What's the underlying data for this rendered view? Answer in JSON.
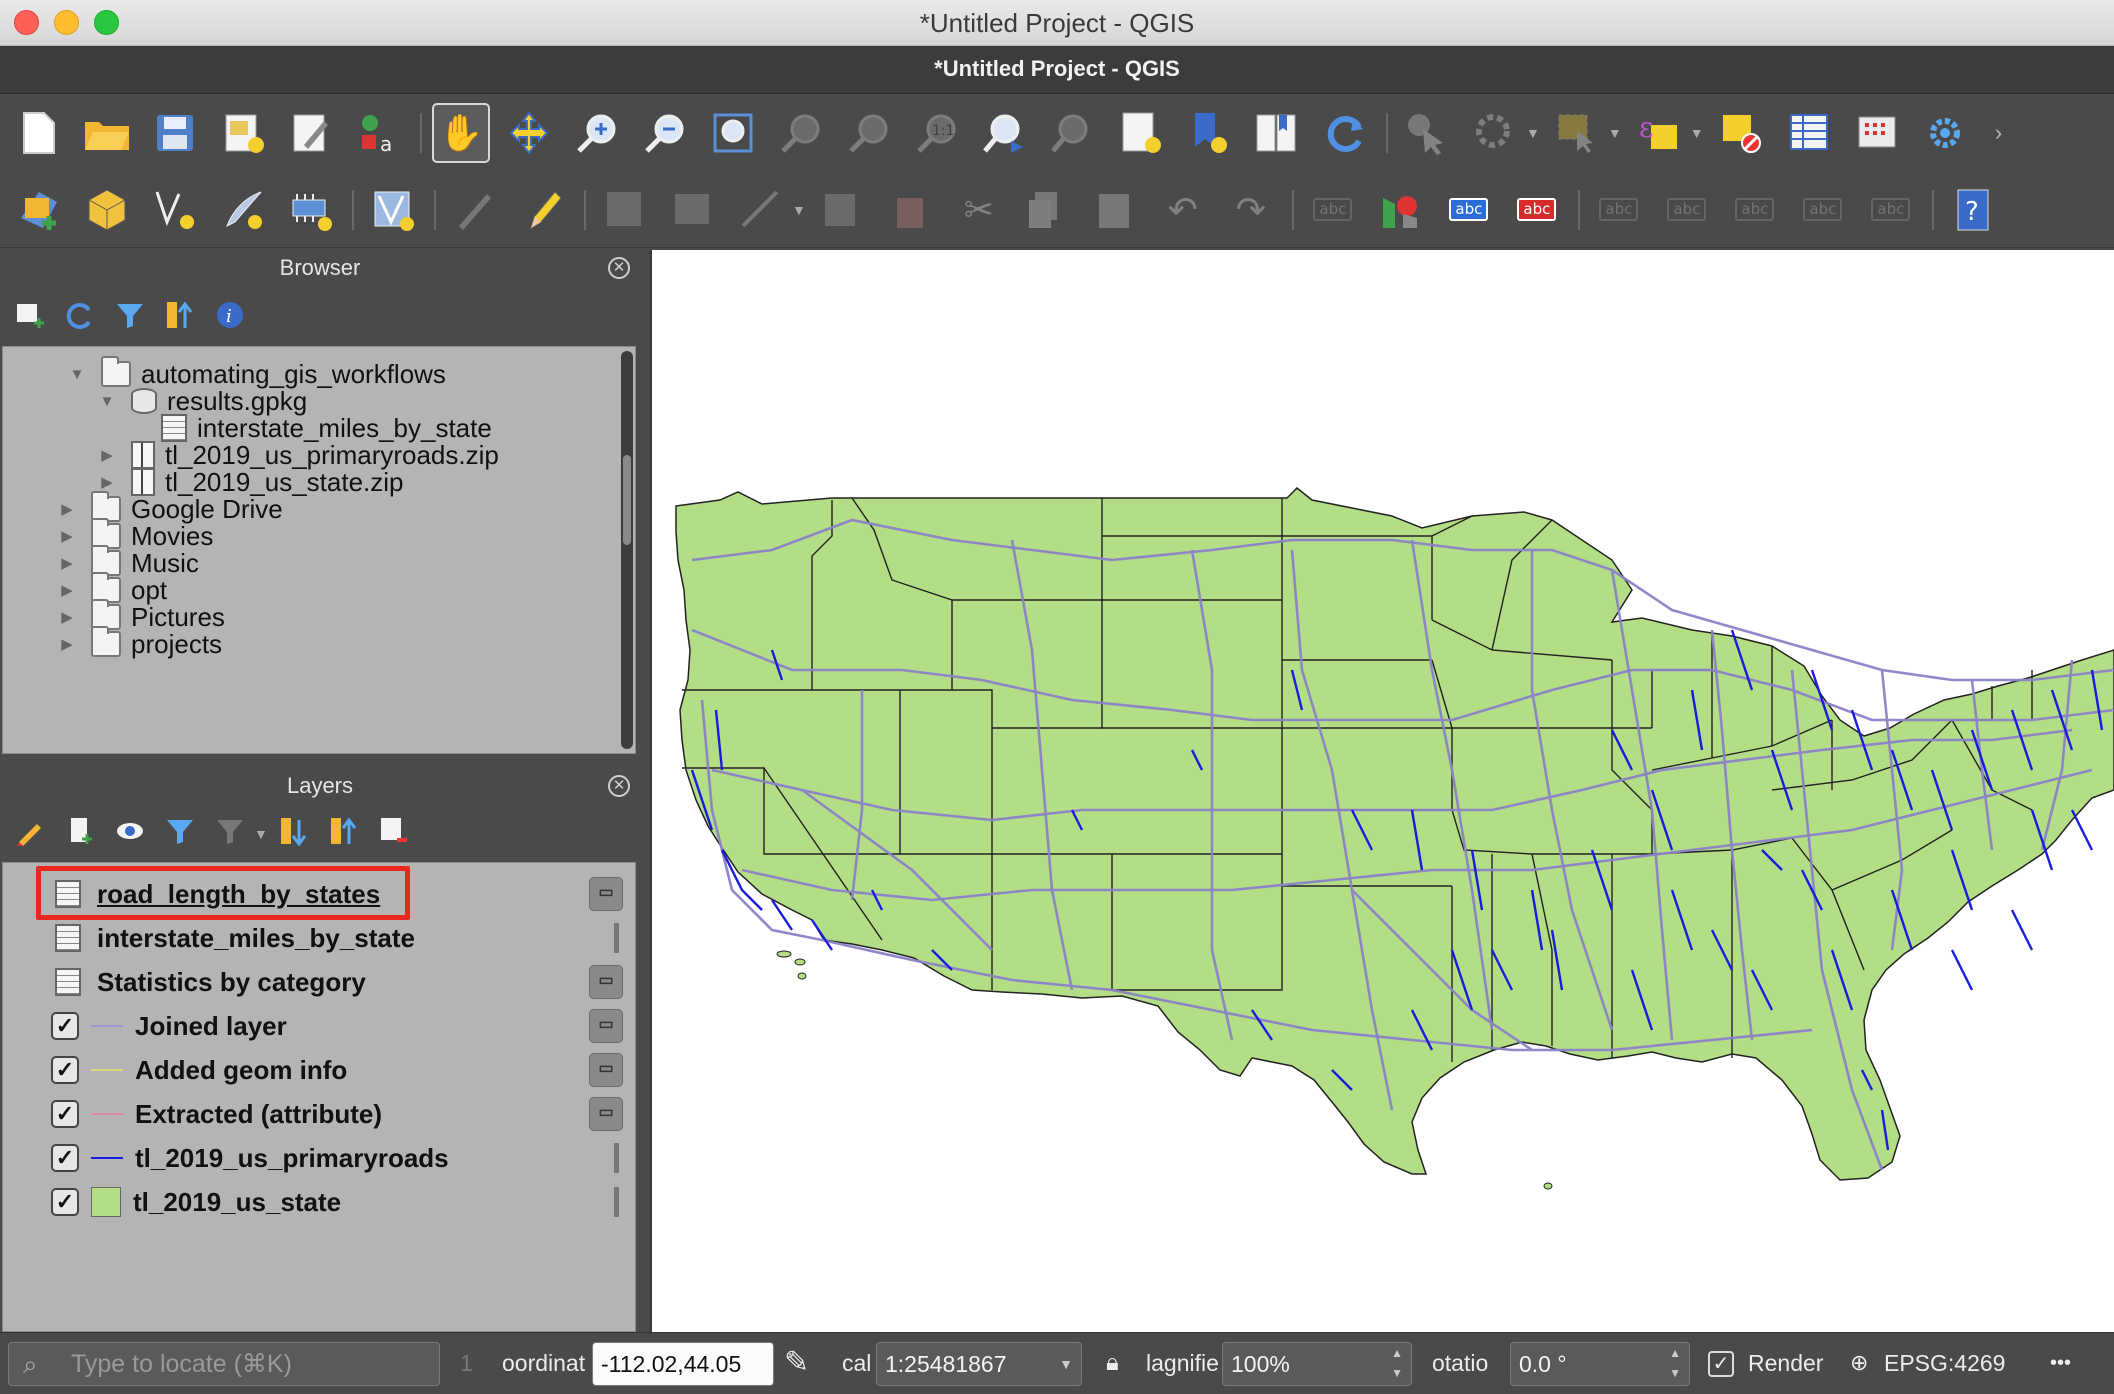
{
  "window": {
    "title": "*Untitled Project - QGIS",
    "app_title": "*Untitled Project - QGIS"
  },
  "toolbar1": {
    "icons": [
      "new-project-icon",
      "open-project-icon",
      "save-project-icon",
      "new-print-layout-icon",
      "layout-manager-icon",
      "style-manager-icon",
      "pan-map-icon",
      "pan-to-selection-icon",
      "zoom-in-icon",
      "zoom-out-icon",
      "zoom-full-icon",
      "zoom-to-selection-icon",
      "zoom-to-layer-icon",
      "zoom-native-icon",
      "zoom-last-icon",
      "zoom-next-icon",
      "new-map-view-icon",
      "new-bookmark-icon",
      "show-bookmarks-icon",
      "refresh-icon",
      "identify-icon",
      "action-icon",
      "select-features-icon",
      "select-by-expression-icon",
      "deselect-icon",
      "attribute-table-icon",
      "statistics-icon",
      "settings-icon"
    ],
    "overflow": "›"
  },
  "toolbar2": {
    "label_tool_text": "abc"
  },
  "browser": {
    "title": "Browser",
    "items": [
      {
        "label": "automating_gis_workflows",
        "expanded": true,
        "kind": "folder"
      },
      {
        "label": "results.gpkg",
        "expanded": true,
        "kind": "geopackage"
      },
      {
        "label": "interstate_miles_by_state",
        "kind": "table"
      },
      {
        "label": "tl_2019_us_primaryroads.zip",
        "kind": "zip"
      },
      {
        "label": "tl_2019_us_state.zip",
        "kind": "zip"
      },
      {
        "label": "Google Drive",
        "kind": "folder"
      },
      {
        "label": "Movies",
        "kind": "folder"
      },
      {
        "label": "Music",
        "kind": "folder"
      },
      {
        "label": "opt",
        "kind": "folder"
      },
      {
        "label": "Pictures",
        "kind": "folder"
      },
      {
        "label": "projects",
        "kind": "folder"
      }
    ]
  },
  "layers": {
    "title": "Layers",
    "items": [
      {
        "label": "road_length_by_states",
        "kind": "table",
        "checked": null,
        "highlighted": true
      },
      {
        "label": "interstate_miles_by_state",
        "kind": "table",
        "checked": null
      },
      {
        "label": "Statistics by category",
        "kind": "table",
        "checked": null
      },
      {
        "label": "Joined layer",
        "kind": "line",
        "checked": true,
        "color": "#9a96d8"
      },
      {
        "label": "Added geom info",
        "kind": "line",
        "checked": true,
        "color": "#d8d87a"
      },
      {
        "label": "Extracted (attribute)",
        "kind": "line",
        "checked": true,
        "color": "#e08aa0"
      },
      {
        "label": "tl_2019_us_primaryroads",
        "kind": "line",
        "checked": true,
        "color": "#1a1ae0"
      },
      {
        "label": "tl_2019_us_state",
        "kind": "polygon",
        "checked": true,
        "color": "#b3de85"
      }
    ],
    "check_mark": "✓"
  },
  "map": {
    "state_fill": "#b3de85",
    "state_stroke": "#222222",
    "road_color": "#1a1ae0",
    "interstate_color": "#8c82c8"
  },
  "statusbar": {
    "locator_placeholder": "Type to locate (⌘K)",
    "message_count": "1",
    "coordinate_label": "oordinat",
    "coordinate_value": "-112.02,44.05",
    "scale_label": "cal",
    "scale_value": "1:25481867",
    "magnifier_label": "lagnifie",
    "magnifier_value": "100%",
    "rotation_label": "otatio",
    "rotation_value": "0.0 °",
    "render_label": "Render",
    "render_checked": true,
    "crs": "EPSG:4269",
    "messages_icon": "•••"
  }
}
